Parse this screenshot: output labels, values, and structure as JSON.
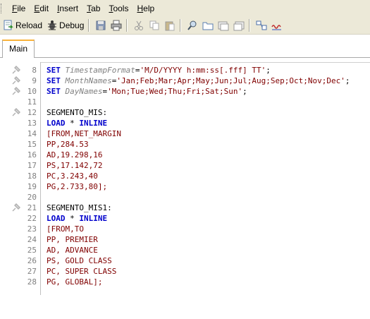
{
  "menu": {
    "items": [
      "File",
      "Edit",
      "Insert",
      "Tab",
      "Tools",
      "Help"
    ]
  },
  "toolbar": {
    "reload_label": "Reload",
    "debug_label": "Debug"
  },
  "tabs": [
    {
      "label": "Main"
    }
  ],
  "editor": {
    "lines": [
      {
        "num": "8",
        "pin": true,
        "tokens": [
          {
            "t": "SET",
            "c": "kw"
          },
          {
            "t": " ",
            "c": "plain"
          },
          {
            "t": "TimestampFormat",
            "c": "var"
          },
          {
            "t": "=",
            "c": "plain"
          },
          {
            "t": "'M/D/YYYY h:mm:ss[.fff] TT'",
            "c": "str"
          },
          {
            "t": ";",
            "c": "plain"
          }
        ]
      },
      {
        "num": "9",
        "pin": true,
        "tokens": [
          {
            "t": "SET",
            "c": "kw"
          },
          {
            "t": " ",
            "c": "plain"
          },
          {
            "t": "MonthNames",
            "c": "var"
          },
          {
            "t": "=",
            "c": "plain"
          },
          {
            "t": "'Jan;Feb;Mar;Apr;May;Jun;Jul;Aug;Sep;Oct;Nov;Dec'",
            "c": "str"
          },
          {
            "t": ";",
            "c": "plain"
          }
        ]
      },
      {
        "num": "10",
        "pin": true,
        "tokens": [
          {
            "t": "SET",
            "c": "kw"
          },
          {
            "t": " ",
            "c": "plain"
          },
          {
            "t": "DayNames",
            "c": "var"
          },
          {
            "t": "=",
            "c": "plain"
          },
          {
            "t": "'Mon;Tue;Wed;Thu;Fri;Sat;Sun'",
            "c": "str"
          },
          {
            "t": ";",
            "c": "plain"
          }
        ]
      },
      {
        "num": "11",
        "pin": false,
        "tokens": []
      },
      {
        "num": "12",
        "pin": true,
        "tokens": [
          {
            "t": "SEGMENTO_MIS:",
            "c": "plain"
          }
        ]
      },
      {
        "num": "13",
        "pin": false,
        "tokens": [
          {
            "t": "LOAD",
            "c": "kw"
          },
          {
            "t": " * ",
            "c": "plain"
          },
          {
            "t": "INLINE",
            "c": "kw"
          }
        ]
      },
      {
        "num": "14",
        "pin": false,
        "tokens": [
          {
            "t": "[FROM,NET_MARGIN",
            "c": "data"
          }
        ]
      },
      {
        "num": "15",
        "pin": false,
        "tokens": [
          {
            "t": "PP,284.53",
            "c": "data"
          }
        ]
      },
      {
        "num": "16",
        "pin": false,
        "tokens": [
          {
            "t": "AD,19.298,16",
            "c": "data"
          }
        ]
      },
      {
        "num": "17",
        "pin": false,
        "tokens": [
          {
            "t": "PS,17.142,72",
            "c": "data"
          }
        ]
      },
      {
        "num": "18",
        "pin": false,
        "tokens": [
          {
            "t": "PC,3.243,40",
            "c": "data"
          }
        ]
      },
      {
        "num": "19",
        "pin": false,
        "tokens": [
          {
            "t": "PG,2.733,80];",
            "c": "data"
          }
        ]
      },
      {
        "num": "20",
        "pin": false,
        "tokens": []
      },
      {
        "num": "21",
        "pin": true,
        "tokens": [
          {
            "t": "SEGMENTO_MIS1:",
            "c": "plain"
          }
        ]
      },
      {
        "num": "22",
        "pin": false,
        "tokens": [
          {
            "t": "LOAD",
            "c": "kw"
          },
          {
            "t": " * ",
            "c": "plain"
          },
          {
            "t": "INLINE",
            "c": "kw"
          }
        ]
      },
      {
        "num": "23",
        "pin": false,
        "tokens": [
          {
            "t": "[FROM,TO",
            "c": "data"
          }
        ]
      },
      {
        "num": "24",
        "pin": false,
        "tokens": [
          {
            "t": "PP, PREMIER",
            "c": "data"
          }
        ]
      },
      {
        "num": "25",
        "pin": false,
        "tokens": [
          {
            "t": "AD, ADVANCE",
            "c": "data"
          }
        ]
      },
      {
        "num": "26",
        "pin": false,
        "tokens": [
          {
            "t": "PS, GOLD CLASS",
            "c": "data"
          }
        ]
      },
      {
        "num": "27",
        "pin": false,
        "tokens": [
          {
            "t": "PC, SUPER CLASS",
            "c": "data"
          }
        ]
      },
      {
        "num": "28",
        "pin": false,
        "tokens": [
          {
            "t": "PG, GLOBAL];",
            "c": "data"
          }
        ]
      }
    ]
  }
}
